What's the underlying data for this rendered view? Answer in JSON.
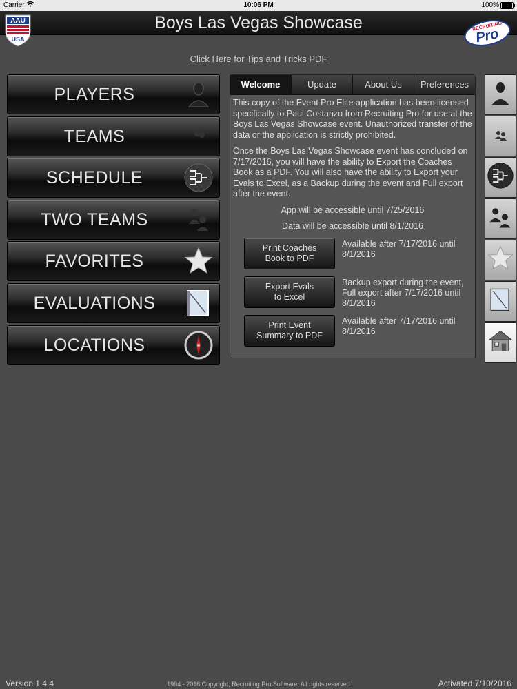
{
  "status_bar": {
    "carrier": "Carrier",
    "time": "10:06 PM",
    "battery": "100%"
  },
  "header": {
    "title": "Boys Las Vegas Showcase",
    "left_logo_text": "AAU",
    "left_logo_sub": "USA",
    "right_logo_top": "RECRUITING",
    "right_logo_main": "Pro"
  },
  "tips_link": "Click Here for Tips and Tricks PDF",
  "menu": [
    {
      "label": "PLAYERS",
      "icon": "player-icon"
    },
    {
      "label": "TEAMS",
      "icon": "team-icon"
    },
    {
      "label": "SCHEDULE",
      "icon": "bracket-icon"
    },
    {
      "label": "TWO TEAMS",
      "icon": "two-teams-icon"
    },
    {
      "label": "FAVORITES",
      "icon": "star-icon"
    },
    {
      "label": "EVALUATIONS",
      "icon": "notebook-icon"
    },
    {
      "label": "LOCATIONS",
      "icon": "compass-icon"
    }
  ],
  "tabs": [
    {
      "label": "Welcome",
      "active": true
    },
    {
      "label": "Update",
      "active": false
    },
    {
      "label": "About Us",
      "active": false
    },
    {
      "label": "Preferences",
      "active": false
    }
  ],
  "welcome": {
    "para1": "This copy of the Event Pro Elite application has been licensed specifically to Paul Costanzo from Recruiting Pro for use at the Boys Las Vegas Showcase event. Unauthorized transfer of the data or the application is strictly prohibited.",
    "para2": "Once the Boys Las Vegas Showcase event has concluded on 7/17/2016, you will have the ability to Export the Coaches Book as a PDF.  You will also have the ability to Export your Evals to Excel, as a Backup during the event and Full export after the event.",
    "access_app": "App will be accessible until 7/25/2016",
    "access_data": "Data will be accessible until 8/1/2016",
    "actions": [
      {
        "line1": "Print Coaches",
        "line2": "Book to PDF",
        "note": "Available after 7/17/2016 until 8/1/2016"
      },
      {
        "line1": "Export Evals",
        "line2": "to Excel",
        "note": "Backup export during the event, Full export after 7/17/2016 until 8/1/2016"
      },
      {
        "line1": "Print Event",
        "line2": "Summary to PDF",
        "note": "Available after 7/17/2016 until 8/1/2016"
      }
    ]
  },
  "sidebar": [
    "player-icon",
    "team-icon",
    "bracket-icon",
    "two-teams-icon",
    "star-icon",
    "notebook-icon",
    "home-icon"
  ],
  "footer": {
    "version": "Version 1.4.4",
    "copyright": "1994 - 2016 Copyright, Recruiting Pro Software, All rights reserved",
    "activated": "Activated 7/10/2016"
  },
  "colors": {
    "background": "#4a4a4a",
    "header": "#1a1a1a",
    "panel": "#555555",
    "aau_red": "#c8102e",
    "aau_blue": "#1f3c88"
  }
}
